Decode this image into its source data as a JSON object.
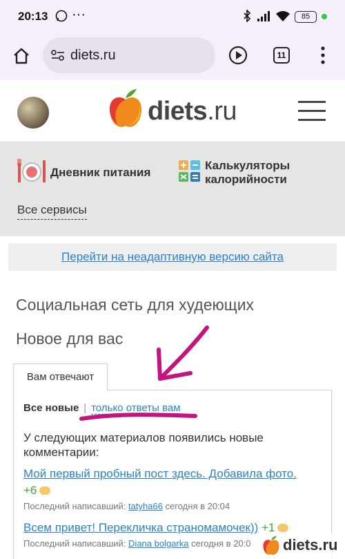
{
  "status_bar": {
    "time": "20:13",
    "battery": "85"
  },
  "browser": {
    "url": "diets.ru",
    "tab_count": "11"
  },
  "site": {
    "logo_main": "diets",
    "logo_suffix": ".ru",
    "services": [
      {
        "label": "Дневник питания",
        "icon": "plate-icon"
      },
      {
        "label": "Калькуляторы калорийности",
        "icon": "calculator-icon"
      }
    ],
    "all_services": "Все сервисы",
    "nonadaptive_link": "Перейти на неадаптивную версию сайта",
    "heading_social": "Социальная сеть для худеющих",
    "heading_new": "Новое для вас"
  },
  "replies": {
    "tab_label": "Вам отвечают",
    "filter_all": "Все новые",
    "filter_separator": "|",
    "filter_mine": "только ответы вам",
    "intro": "У следующих материалов появились новые комментарии:",
    "posts": [
      {
        "title": "Мой первый пробный пост здесь. Добавила фото.",
        "count": "+6",
        "meta_prefix": "Последний написавший:",
        "author": "tatyha66",
        "time": "сегодня в 20:04"
      },
      {
        "title": "Всем привет! Перекличка страномамочек))",
        "count": "+1",
        "meta_prefix": "Последний написавший:",
        "author": "Diana bolgarka",
        "time": "сегодня в 20:0"
      }
    ]
  },
  "watermark": {
    "text": "diets.ru"
  },
  "colors": {
    "link": "#2b82c9",
    "plus": "#3aa832",
    "annotation": "#c2157e",
    "browser_bg": "#f6eef8"
  }
}
